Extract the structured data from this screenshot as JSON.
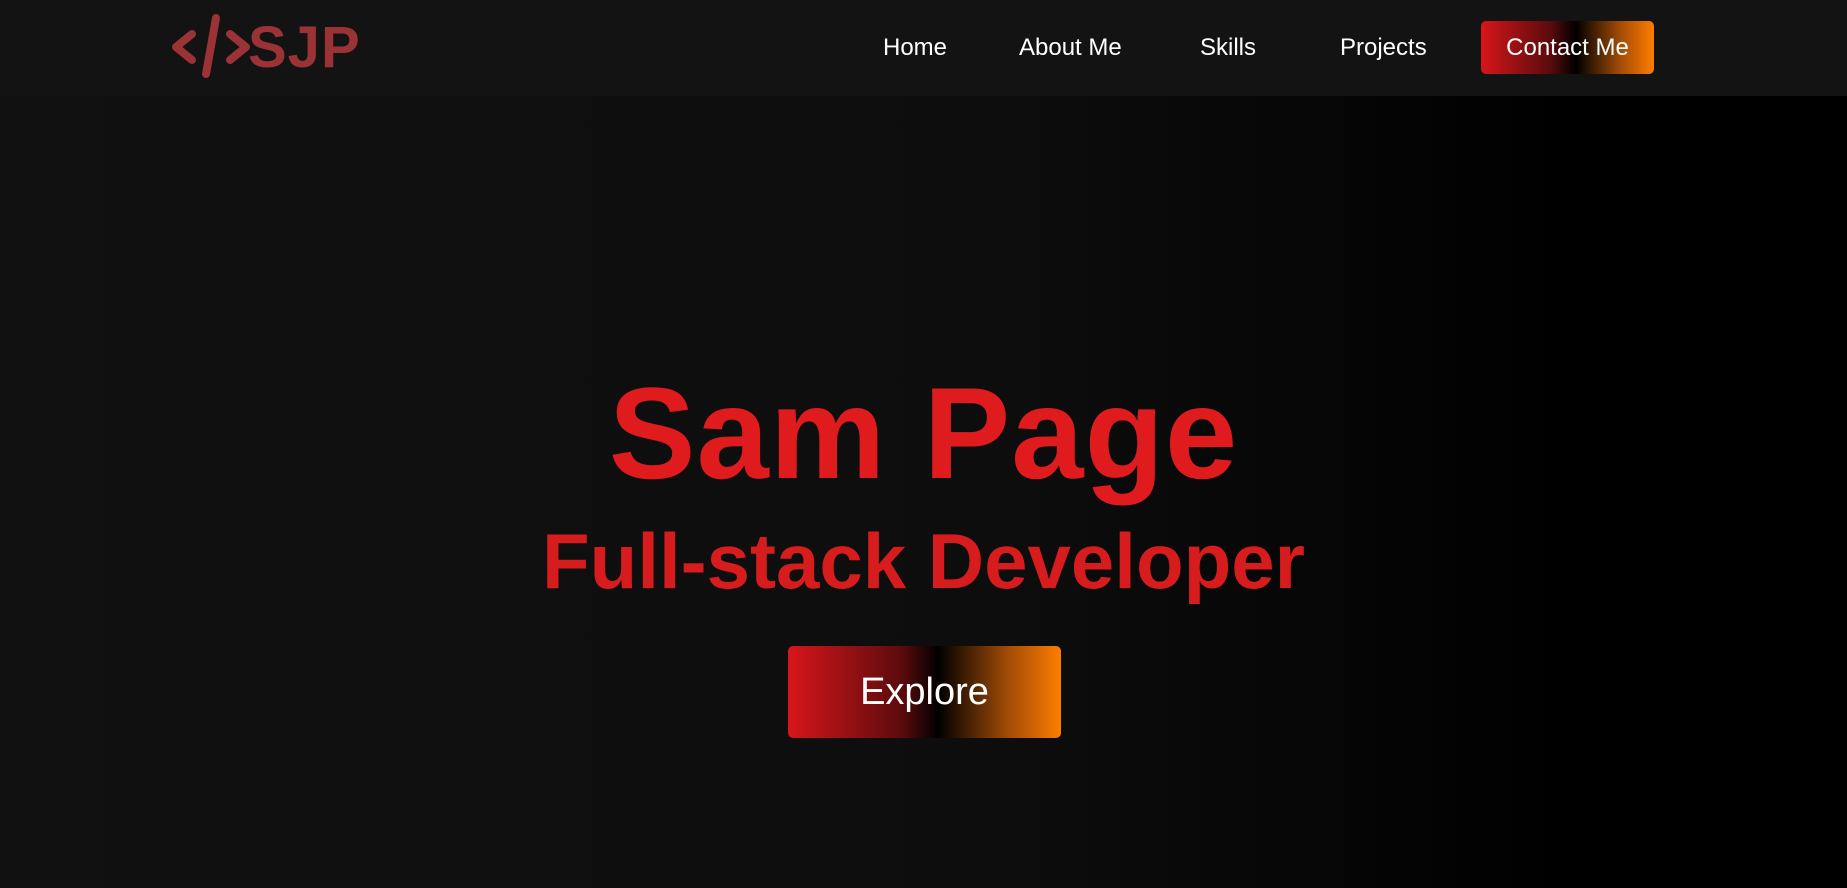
{
  "brand": {
    "logo_text": "SJP",
    "logo_icon": "code-brackets-icon",
    "logo_color": "#9a3236"
  },
  "nav": {
    "items": [
      {
        "label": "Home"
      },
      {
        "label": "About Me"
      },
      {
        "label": "Skills"
      },
      {
        "label": "Projects"
      }
    ],
    "cta_label": "Contact Me"
  },
  "hero": {
    "name": "Sam Page",
    "role": "Full-stack Developer",
    "cta_label": "Explore"
  },
  "colors": {
    "accent_red": "#df1b1d",
    "accent_orange": "#ff7d00",
    "background": "#0f0f0f",
    "navbar": "#131313"
  }
}
